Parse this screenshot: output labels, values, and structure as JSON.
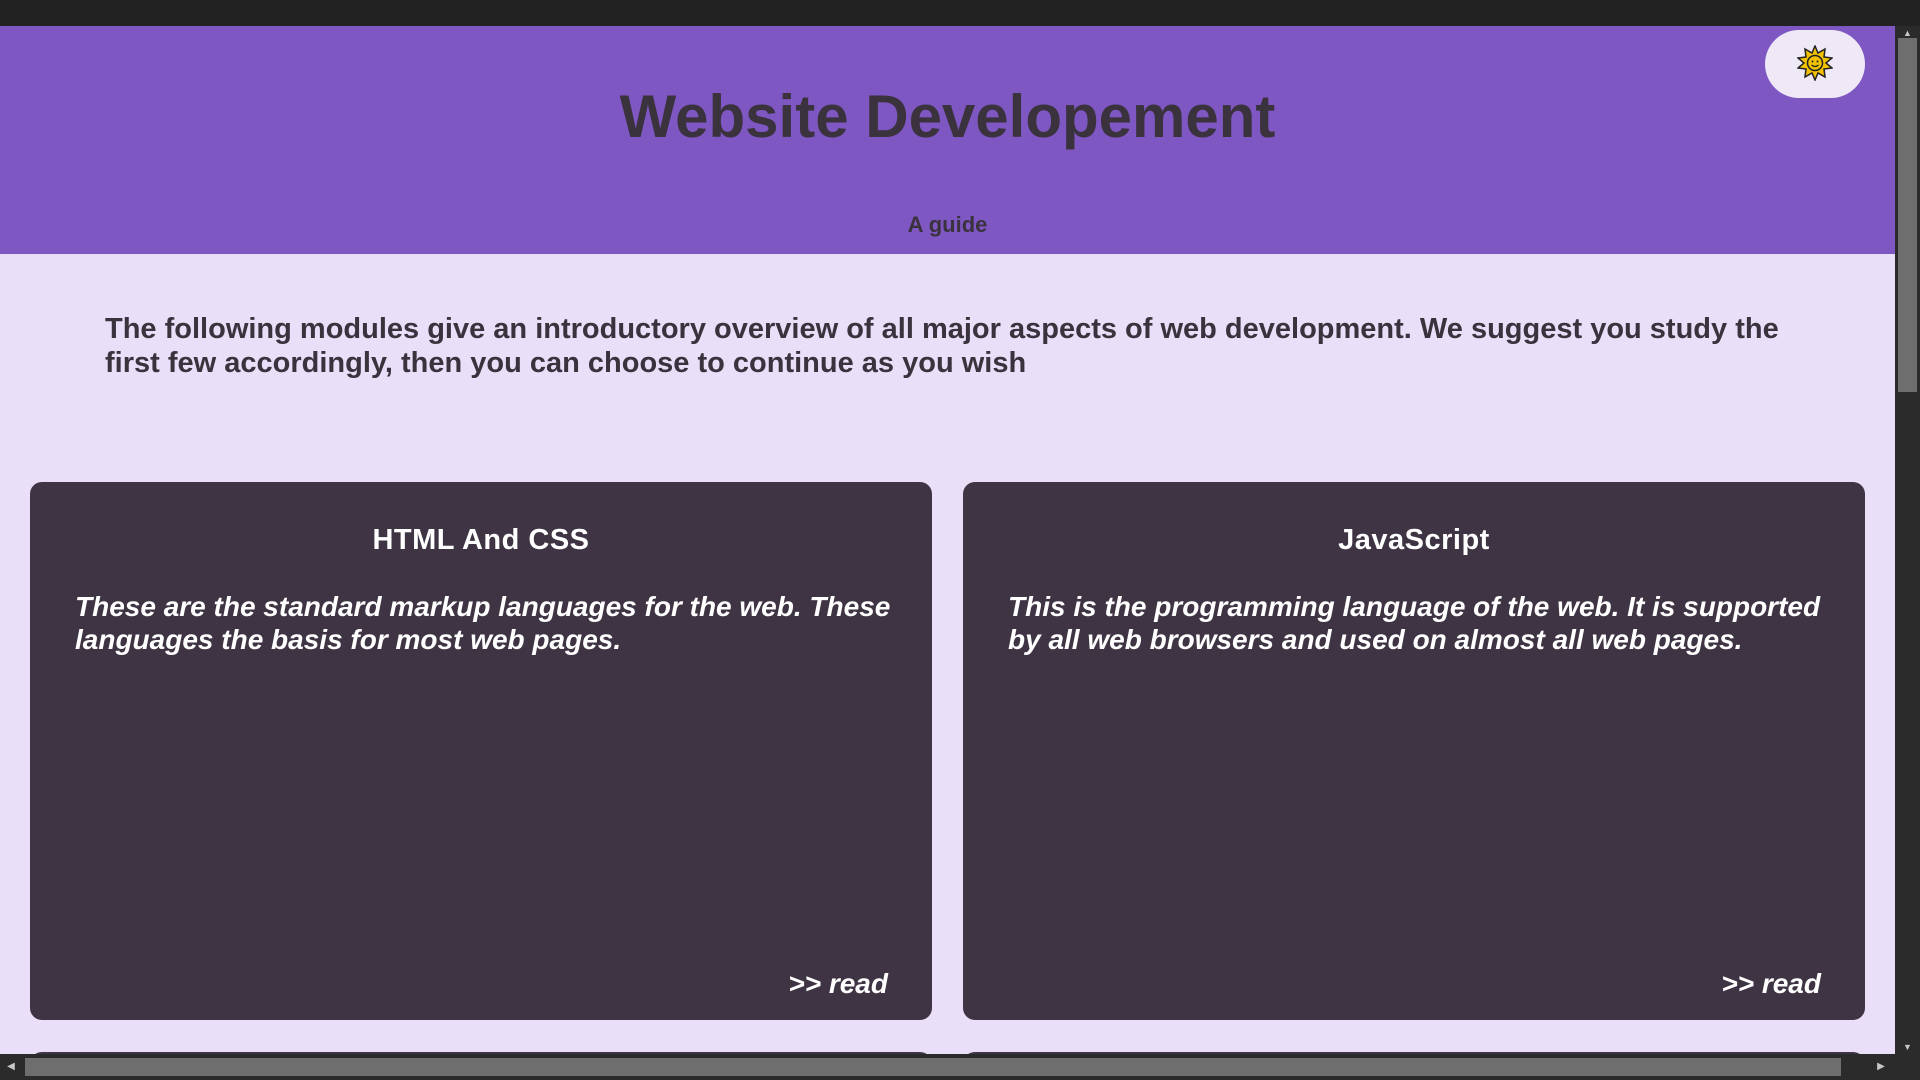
{
  "header": {
    "title": "Website Developement",
    "subtitle": "A guide",
    "theme_toggle_icon": "sun-icon",
    "background_color": "#7e57c2"
  },
  "intro": {
    "text": "The following modules give an introductory overview of all major aspects of web development. We suggest you study the first few accordingly, then you can choose to continue as you wish"
  },
  "modules": [
    {
      "title": "HTML And CSS",
      "description": "These are the standard markup languages for the web. These languages the basis for most web pages.",
      "link_label": ">> read"
    },
    {
      "title": "JavaScript",
      "description": "This is the programming language of the web. It is supported by all web browsers and used on almost all web pages.",
      "link_label": ">> read"
    }
  ],
  "colors": {
    "page_background": "#e9dff8",
    "card_background": "#3f3443",
    "text_dark": "#3a323d"
  }
}
